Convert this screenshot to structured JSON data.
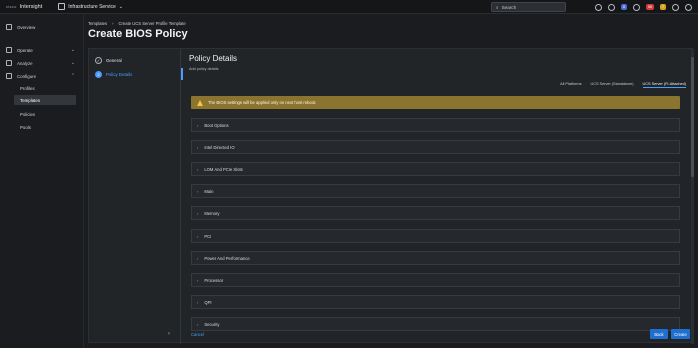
{
  "topbar": {
    "brand_small": "cisco",
    "brand": "Intersight",
    "service": "Infrastructure Service",
    "search_placeholder": "Search",
    "badge_critical": "56",
    "badge_warning": "7",
    "badge_info": "8",
    "colors": {
      "critical": "#d13b3b",
      "warning": "#d7a421",
      "info": "#4a6cd6"
    }
  },
  "sidebar": {
    "items": [
      {
        "label": "Overview",
        "icon": "globe-icon"
      },
      {
        "label": "Operate",
        "icon": "gear-icon"
      },
      {
        "label": "Analyze",
        "icon": "analyze-icon"
      },
      {
        "label": "Configure",
        "icon": "wrench-icon"
      }
    ],
    "sub_items": [
      "Profiles",
      "Templates",
      "Policies",
      "Pools"
    ],
    "active_sub": "Templates"
  },
  "header": {
    "breadcrumb": [
      "Templates",
      "Create UCS Server Profile Template"
    ],
    "title": "Create BIOS Policy"
  },
  "wizard": {
    "steps": [
      {
        "label": "General",
        "state": "done"
      },
      {
        "label": "Policy Details",
        "state": "current",
        "number": "2"
      }
    ],
    "details_title": "Policy Details",
    "details_subtitle": "Add policy details",
    "tabs": [
      "All Platforms",
      "UCS Server (Standalone)",
      "UCS Server (FI-Attached)"
    ],
    "active_tab": "UCS Server (FI-Attached)",
    "warning": "The BIOS settings will be applied only on next host reboot.",
    "sections": [
      "Boot Options",
      "Intel Directed IO",
      "LOM And PCIe Slots",
      "Main",
      "Memory",
      "PCI",
      "Power And Performance",
      "Processor",
      "QPI",
      "Security"
    ],
    "cancel_label": "Cancel",
    "back_label": "Back",
    "create_label": "Create",
    "accent_color": "#1f6fd1"
  }
}
